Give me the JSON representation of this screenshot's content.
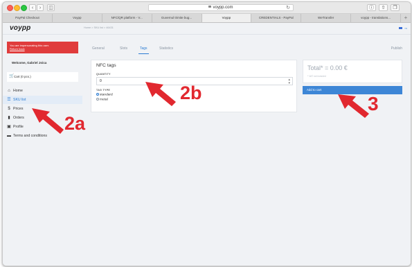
{
  "browser": {
    "url": "voypp.com",
    "tabs": [
      {
        "label": "PayPal Checkout",
        "active": false
      },
      {
        "label": "Voypp",
        "active": false
      },
      {
        "label": "NFC/QR platform - V...",
        "active": false
      },
      {
        "label": "Guvernul trimite bug...",
        "active": false
      },
      {
        "label": "Voypp",
        "active": true
      },
      {
        "label": "CREDENTIALS - PayPal",
        "active": false
      },
      {
        "label": "WeTransfer",
        "active": false
      },
      {
        "label": "voypp - translations...",
        "active": false
      }
    ],
    "new_tab": "+"
  },
  "header": {
    "logo": "voypp",
    "breadcrumb": "Home  >  SKU list  >  46431",
    "lang": "ro"
  },
  "sidebar": {
    "impersonation_text": "You are impersonating this user.",
    "return_link": "Return back",
    "welcome": "Welcome, Gabriel Joica",
    "cart_label": "Cart (0 pcs.)",
    "nav": [
      {
        "label": "Home",
        "icon": "home-icon",
        "active": false
      },
      {
        "label": "SKU list",
        "icon": "list-icon",
        "active": true
      },
      {
        "label": "Prices",
        "icon": "dollar-icon",
        "active": false
      },
      {
        "label": "Orders",
        "icon": "document-icon",
        "active": false
      },
      {
        "label": "Profile",
        "icon": "id-card-icon",
        "active": false
      },
      {
        "label": "Terms and conditions",
        "icon": "book-icon",
        "active": false
      }
    ]
  },
  "content": {
    "tabs": [
      {
        "label": "General",
        "active": false
      },
      {
        "label": "Slots",
        "active": false
      },
      {
        "label": "Tags",
        "active": true
      },
      {
        "label": "Statistics",
        "active": false
      }
    ],
    "publish_label": "Publish",
    "nfc_card": {
      "title": "NFC tags",
      "quantity_label": "QUANTITY",
      "quantity_value": "0",
      "tag_type_label": "TAG TYPE",
      "tag_types": [
        {
          "label": "standard",
          "selected": true
        },
        {
          "label": "metal",
          "selected": false
        }
      ]
    },
    "total": {
      "label": "Total* = 0.00 €",
      "vat_note": "* VAT not included"
    },
    "add_to_cart": "Add to cart"
  },
  "annotations": {
    "color": "#e1282f",
    "labels": [
      "2a",
      "2b",
      "3"
    ]
  },
  "colors": {
    "accent": "#2b7cd3",
    "alert": "#e03c3c",
    "button": "#3d86d6"
  }
}
